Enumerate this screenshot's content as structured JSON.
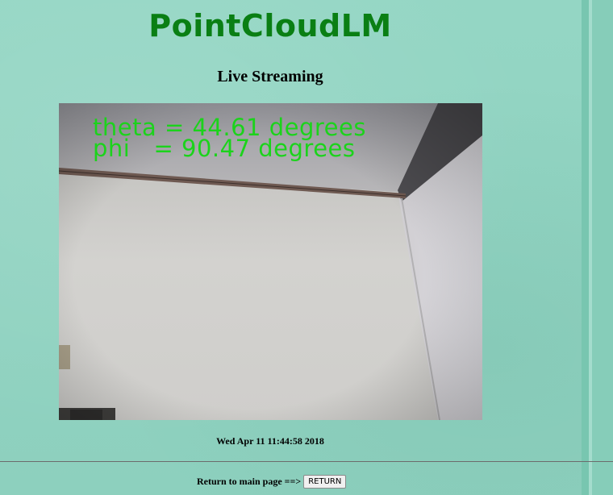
{
  "header": {
    "app_title": "PointCloudLM",
    "page_heading": "Live Streaming"
  },
  "stream": {
    "overlay_line_1": "theta = 44.61 degrees",
    "overlay_line_2": "phi   = 90.47 degrees"
  },
  "footer": {
    "timestamp": "Wed Apr 11 11:44:58 2018",
    "return_label": "Return to main page ==>",
    "return_button": "RETURN"
  },
  "colors": {
    "page_background": "#8fd3c0",
    "title_color": "#0a7f14",
    "overlay_text_color": "#1bd31b"
  }
}
